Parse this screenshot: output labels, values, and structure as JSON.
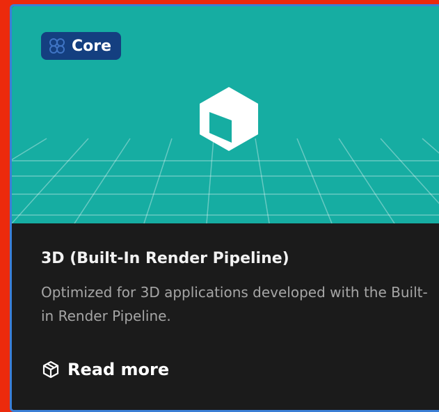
{
  "card": {
    "badge": {
      "label": "Core",
      "icon": "core-icon"
    },
    "hero": {
      "icon": "cube-icon",
      "background_color": "#16ada2"
    },
    "title": "3D (Built-In Render Pipeline)",
    "description": "Optimized for 3D applications developed with the Built-in Render Pipeline.",
    "read_more": {
      "label": "Read more",
      "icon": "package-icon"
    },
    "colors": {
      "accent_border": "#3b7fd6",
      "badge_background": "#143f80",
      "card_background": "#1b1b1b",
      "outer_background": "#ec2a0c"
    }
  }
}
